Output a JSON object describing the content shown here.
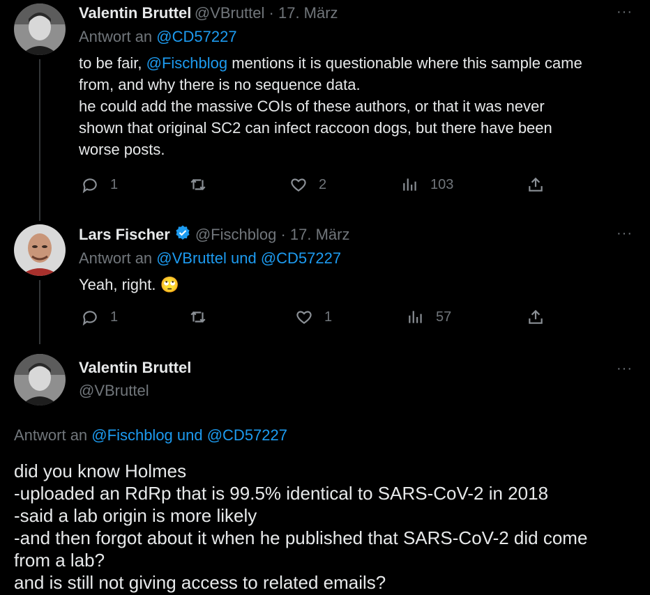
{
  "tweet1": {
    "name": "Valentin Bruttel",
    "handle": "@VBruttel",
    "sep": " · ",
    "date": "17. März",
    "reply_prefix": "Antwort an",
    "reply_to": "@CD57227",
    "text_prefix": "to be fair,",
    "mention": "@Fischblog",
    "text_line1_rest": "mentions it is questionable where this sample came",
    "text_line2": "from, and why there is no sequence data.",
    "text_line3": "he could add the massive COIs of these authors, or that it was never",
    "text_line4": "shown that original SC2 can infect raccoon dogs, but there have been",
    "text_line5": "worse posts.",
    "replies": "1",
    "retweets": "",
    "likes": "2",
    "views": "103",
    "more": "···"
  },
  "tweet2": {
    "name": "Lars Fischer",
    "handle": "@Fischblog",
    "sep": " · ",
    "date": "17. März",
    "reply_prefix": "Antwort an",
    "reply_to": "@VBruttel und @CD57227",
    "text": "Yeah, right.",
    "emoji": "🙄",
    "replies": "1",
    "likes": "1",
    "views": "57",
    "more": "···"
  },
  "tweet3": {
    "name": "Valentin Bruttel",
    "handle": "@VBruttel",
    "reply_prefix": "Antwort an",
    "reply_to": "@Fischblog und @CD57227",
    "lines": [
      "did you know Holmes",
      "-uploaded an RdRp that is 99.5% identical to SARS-CoV-2 in 2018",
      "-said a lab origin is more likely",
      "-and then forgot about it when he published that SARS-CoV-2 did come",
      "from a lab?",
      "and is still not giving access to related emails?"
    ],
    "more": "···"
  },
  "colors": {
    "background": "#000000",
    "text": "#e7e9ea",
    "muted": "#71767b",
    "link": "#1d9bf0",
    "verified": "#1d9bf0"
  }
}
